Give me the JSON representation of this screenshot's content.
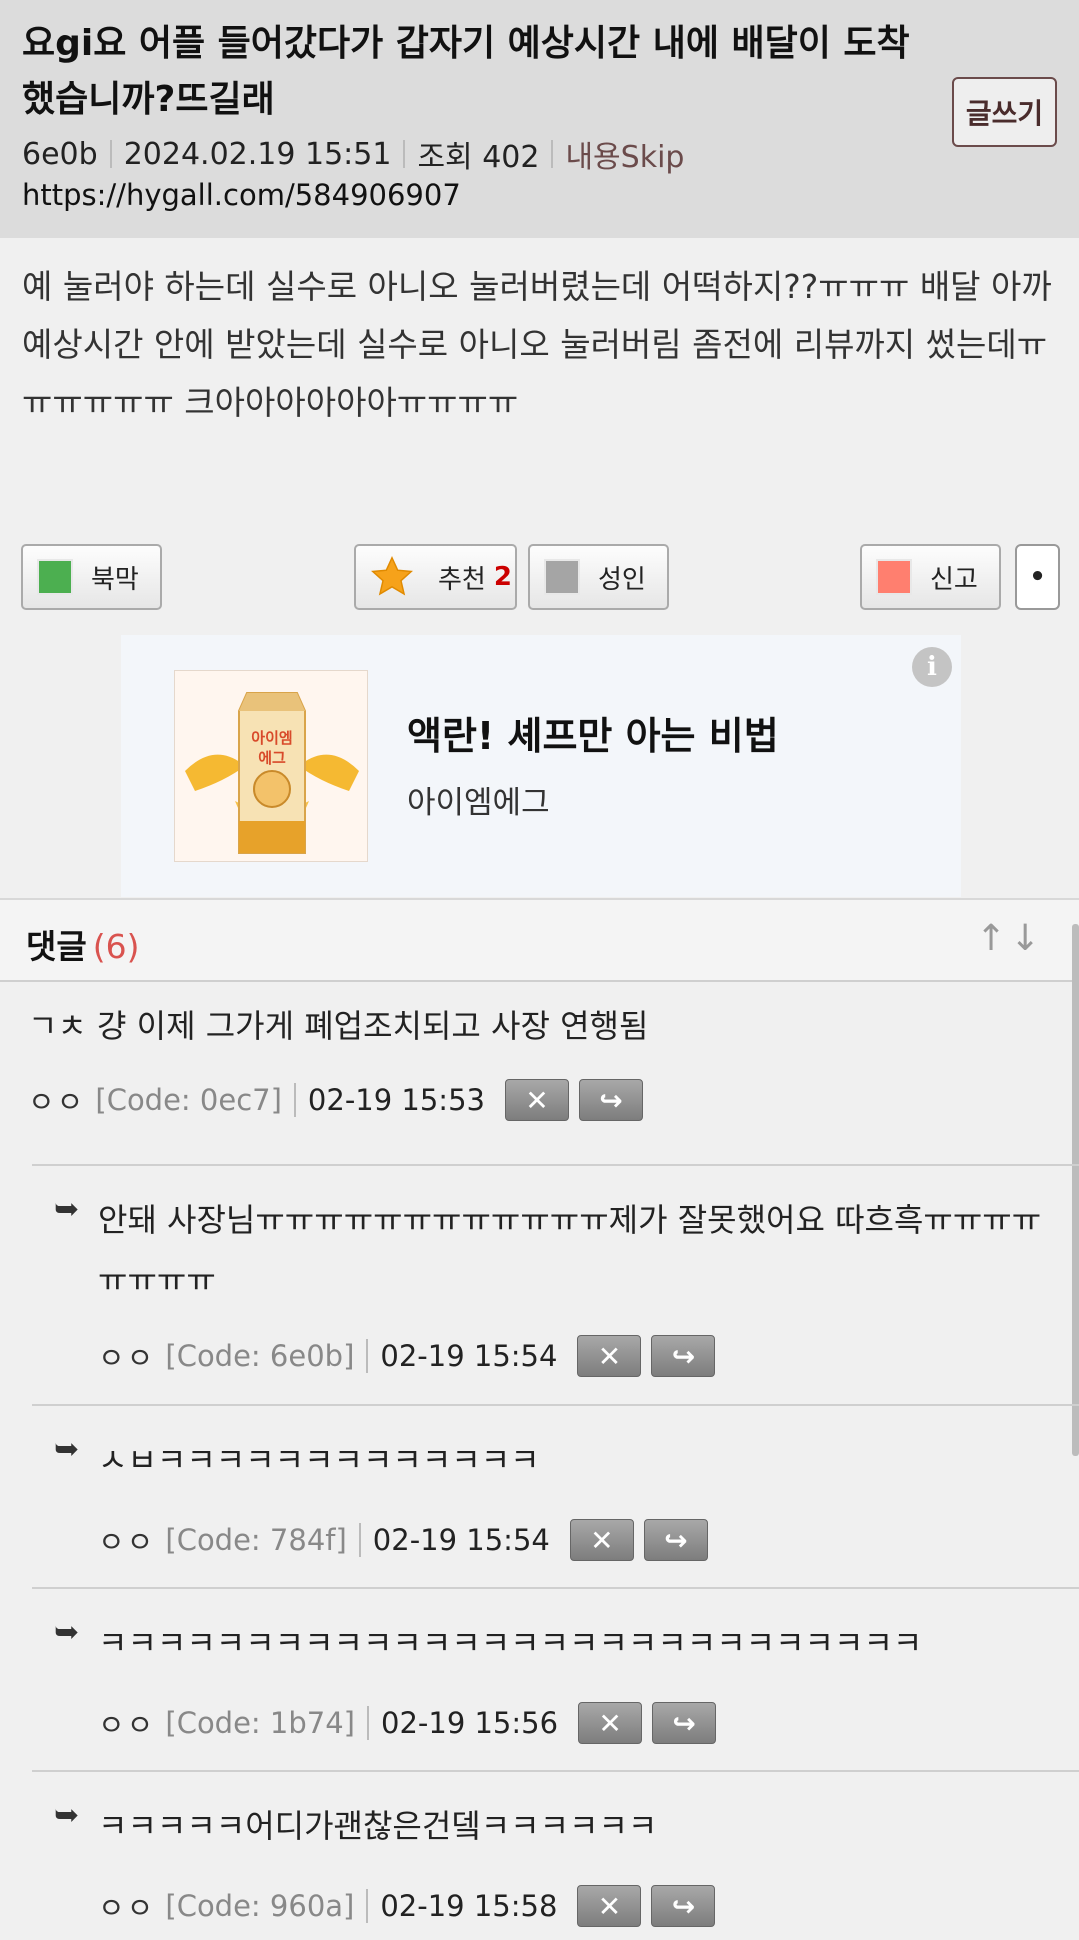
{
  "post": {
    "title": "요gi요 어플 들어갔다가 갑자기 예상시간 내에 배달이 도착했습니까?뜨길래",
    "write_label": "글쓰기",
    "author": "6e0b",
    "date": "2024.02.19 15:51",
    "views": "조회 402",
    "skip_label": "내용Skip",
    "url": "https://hygall.com/584906907",
    "body": "예 눌러야 하는데 실수로 아니오 눌러버렸는데 어떡하지??ㅠㅠㅠ 배달 아까 예상시간 안에 받았는데 실수로 아니오 눌러버림 좀전에 리뷰까지 썼는데ㅠㅠㅠㅠㅠㅠ 크아아아아아아ㅠㅠㅠㅠ"
  },
  "actions": {
    "bookmark": "북막",
    "recommend": "추천",
    "recommend_count": "2",
    "adult": "성인",
    "report": "신고",
    "more": "•"
  },
  "ad": {
    "headline": "액란! 셰프만 아는 비법",
    "advertiser": "아이엠에그",
    "product_text": "아이엠\n에그",
    "info_icon": "i"
  },
  "comments_section": {
    "title": "댓글",
    "count": "(6)",
    "arrows": "↑↓"
  },
  "comments": [
    {
      "text": "ㄱㅊ 걍 이제 그가게 폐업조치되고 사장 연행됨",
      "nick": "ㅇㅇ",
      "code": "[Code: 0ec7]",
      "time": "02-19 15:53"
    },
    {
      "text": "안돼 사장님ㅠㅠㅠㅠㅠㅠㅠㅠㅠㅠㅠㅠ제가 잘못했어요 따흐흑ㅠㅠㅠㅠㅠㅠㅠㅠ",
      "nick": "ㅇㅇ",
      "code": "[Code: 6e0b]",
      "time": "02-19 15:54"
    },
    {
      "text": "ㅅㅂㅋㅋㅋㅋㅋㅋㅋㅋㅋㅋㅋㅋㅋ",
      "nick": "ㅇㅇ",
      "code": "[Code: 784f]",
      "time": "02-19 15:54"
    },
    {
      "text": "ㅋㅋㅋㅋㅋㅋㅋㅋㅋㅋㅋㅋㅋㅋㅋㅋㅋㅋㅋㅋㅋㅋㅋㅋㅋㅋㅋㅋ",
      "nick": "ㅇㅇ",
      "code": "[Code: 1b74]",
      "time": "02-19 15:56"
    },
    {
      "text": "ㅋㅋㅋㅋㅋ어디가괜찮은건뎈ㅋㅋㅋㅋㅋㅋ",
      "nick": "ㅇㅇ",
      "code": "[Code: 960a]",
      "time": "02-19 15:58"
    }
  ],
  "comment_buttons": {
    "delete": "✕",
    "reply": "↪"
  },
  "colors": {
    "header_bg": "#dcdcdc",
    "accent": "#6b4b4b",
    "count_red": "#d9534f",
    "bookmark": "#4caf50",
    "report": "#ff7f6f"
  }
}
